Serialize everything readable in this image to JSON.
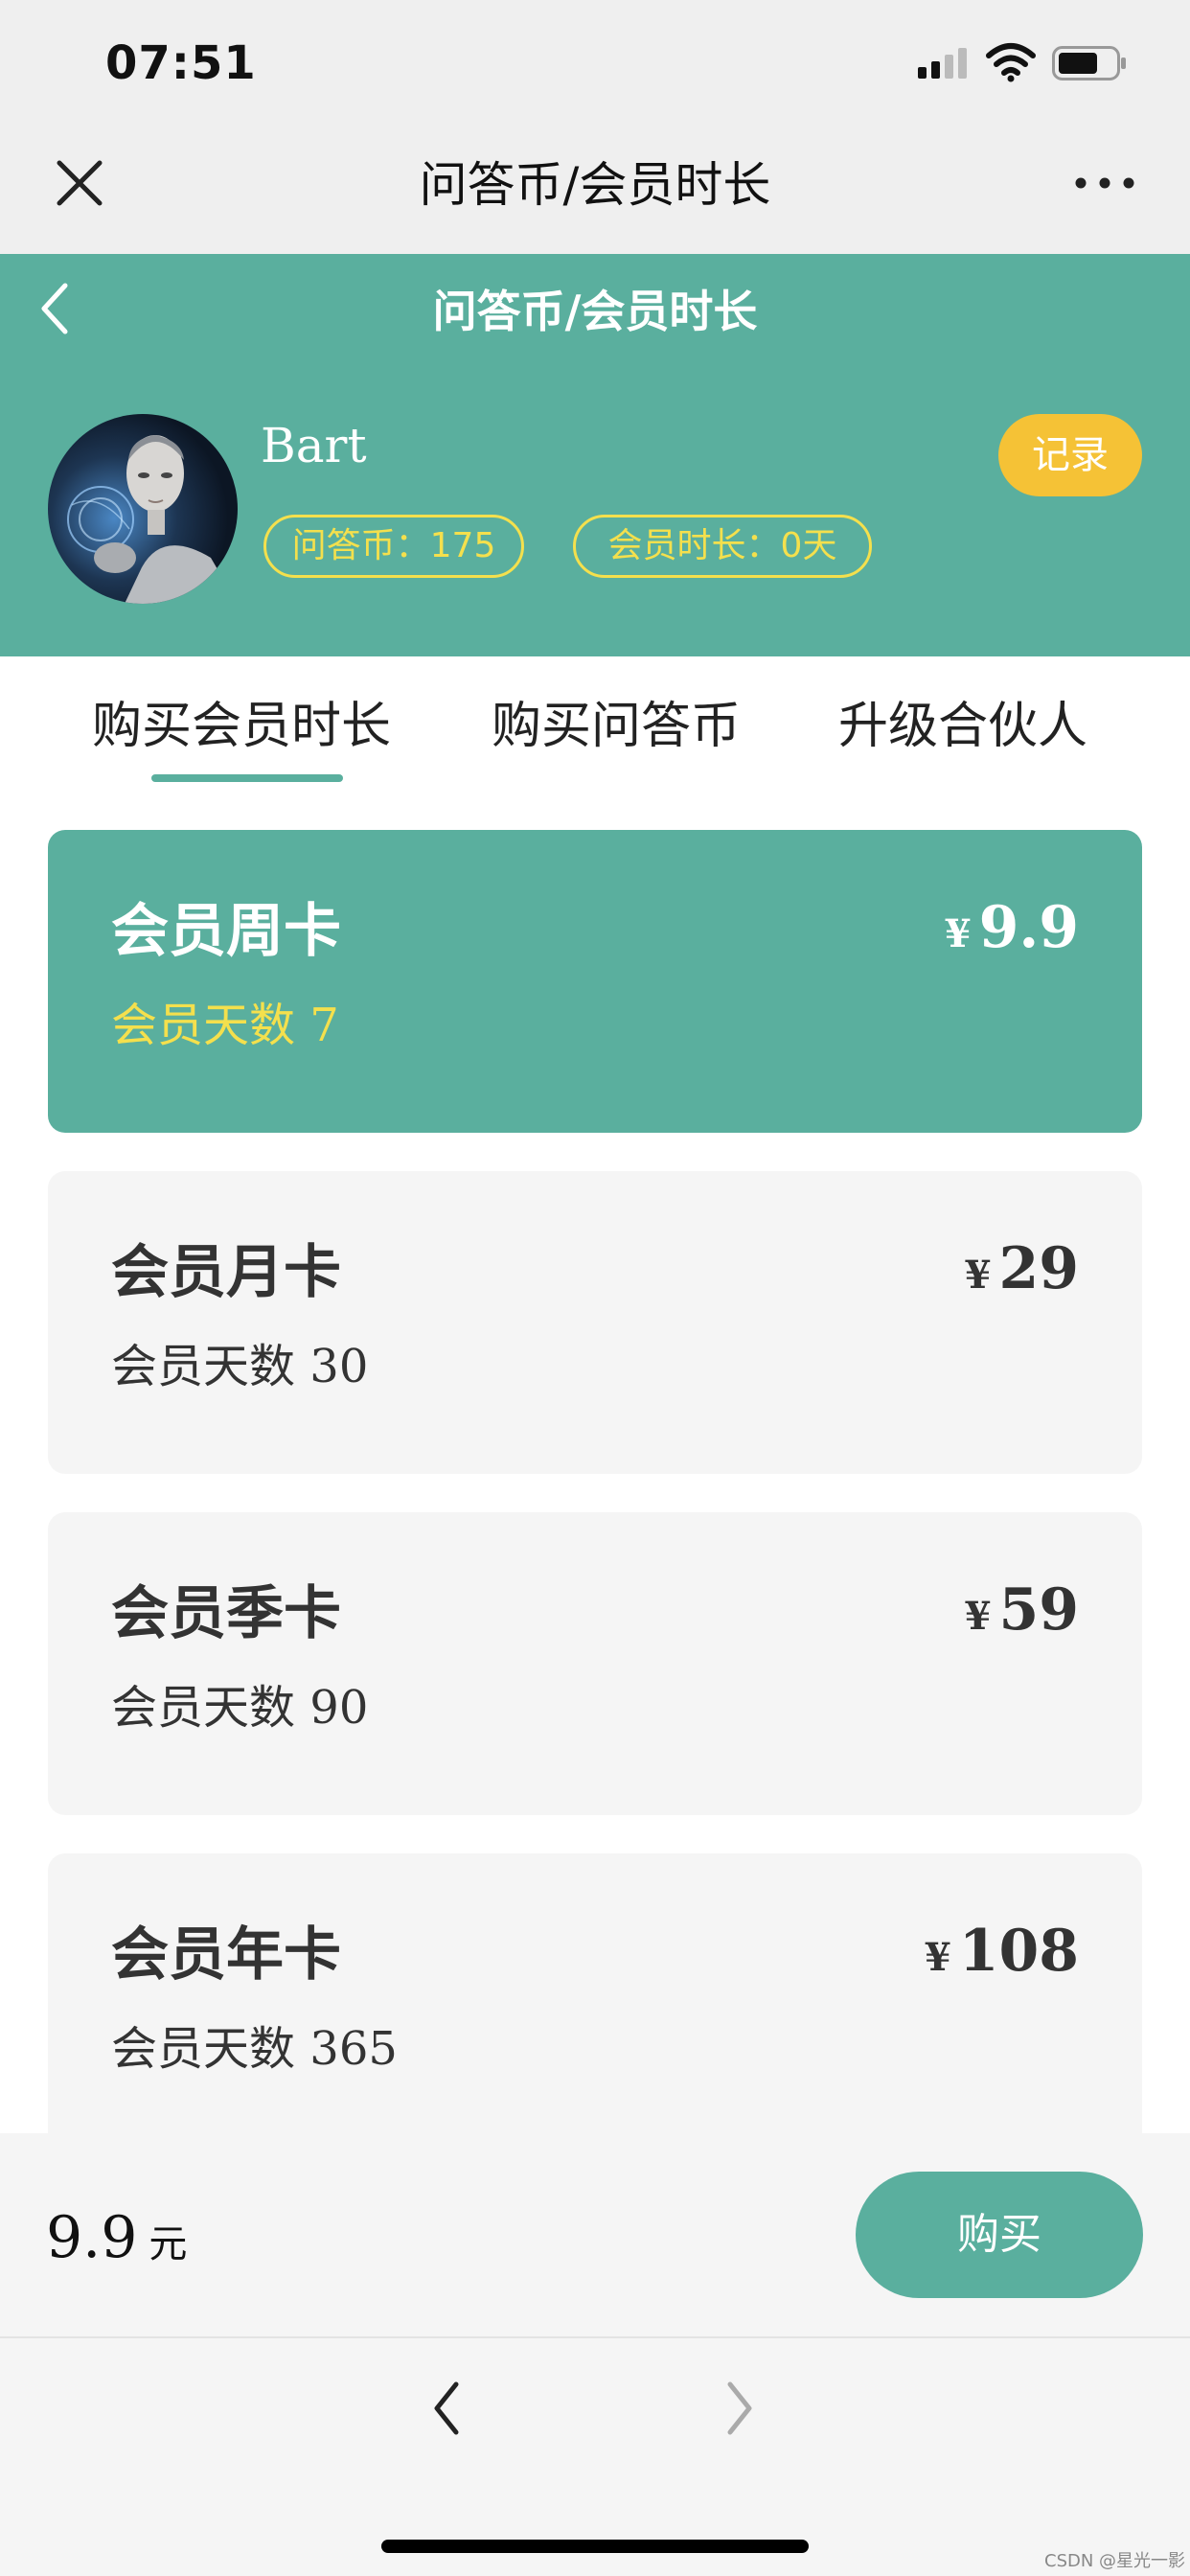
{
  "status_bar": {
    "time": "07:51"
  },
  "wx_nav": {
    "title": "问答币/会员时长"
  },
  "header": {
    "title": "问答币/会员时长",
    "username": "Bart",
    "coins_label": "问答币：175",
    "member_label": "会员时长：0天",
    "record_label": "记录"
  },
  "tabs": [
    {
      "label": "购买会员时长",
      "active": true
    },
    {
      "label": "购买问答币",
      "active": false
    },
    {
      "label": "升级合伙人",
      "active": false
    }
  ],
  "plans": [
    {
      "title": "会员周卡",
      "days_label": "会员天数",
      "days": "7",
      "currency": "¥",
      "price": "9.9",
      "selected": true
    },
    {
      "title": "会员月卡",
      "days_label": "会员天数",
      "days": "30",
      "currency": "¥",
      "price": "29",
      "selected": false
    },
    {
      "title": "会员季卡",
      "days_label": "会员天数",
      "days": "90",
      "currency": "¥",
      "price": "59",
      "selected": false
    },
    {
      "title": "会员年卡",
      "days_label": "会员天数",
      "days": "365",
      "currency": "¥",
      "price": "108",
      "selected": false
    }
  ],
  "footer": {
    "total": "9.9",
    "unit": "元",
    "buy_label": "购买"
  },
  "watermark": "CSDN @星光一影",
  "colors": {
    "accent": "#5aaf9e",
    "highlight": "#f4e04d",
    "record": "#f5c236"
  }
}
